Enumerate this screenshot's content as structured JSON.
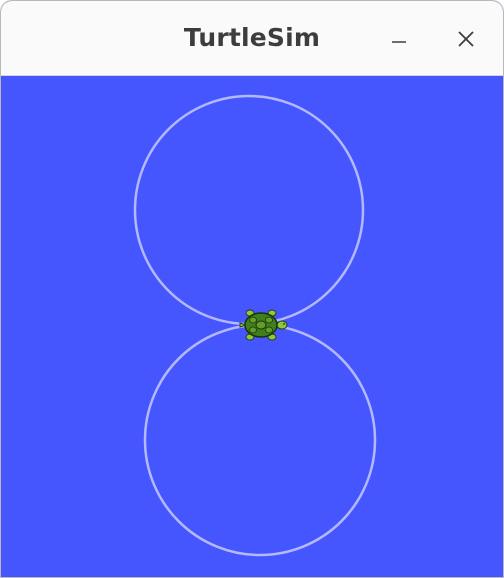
{
  "window": {
    "title": "TurtleSim",
    "minimize_label": "minimize",
    "close_label": "close"
  },
  "colors": {
    "background": "#4556ff",
    "pen": "#b3b8ff",
    "titlebar": "#fafafa",
    "title_text": "#3d3d3d",
    "turtle_shell": "#3f7f1c",
    "turtle_skin": "#8ec63f"
  },
  "icons": {
    "minimize": "minimize-icon",
    "close": "close-icon",
    "turtle": "turtle-icon"
  }
}
